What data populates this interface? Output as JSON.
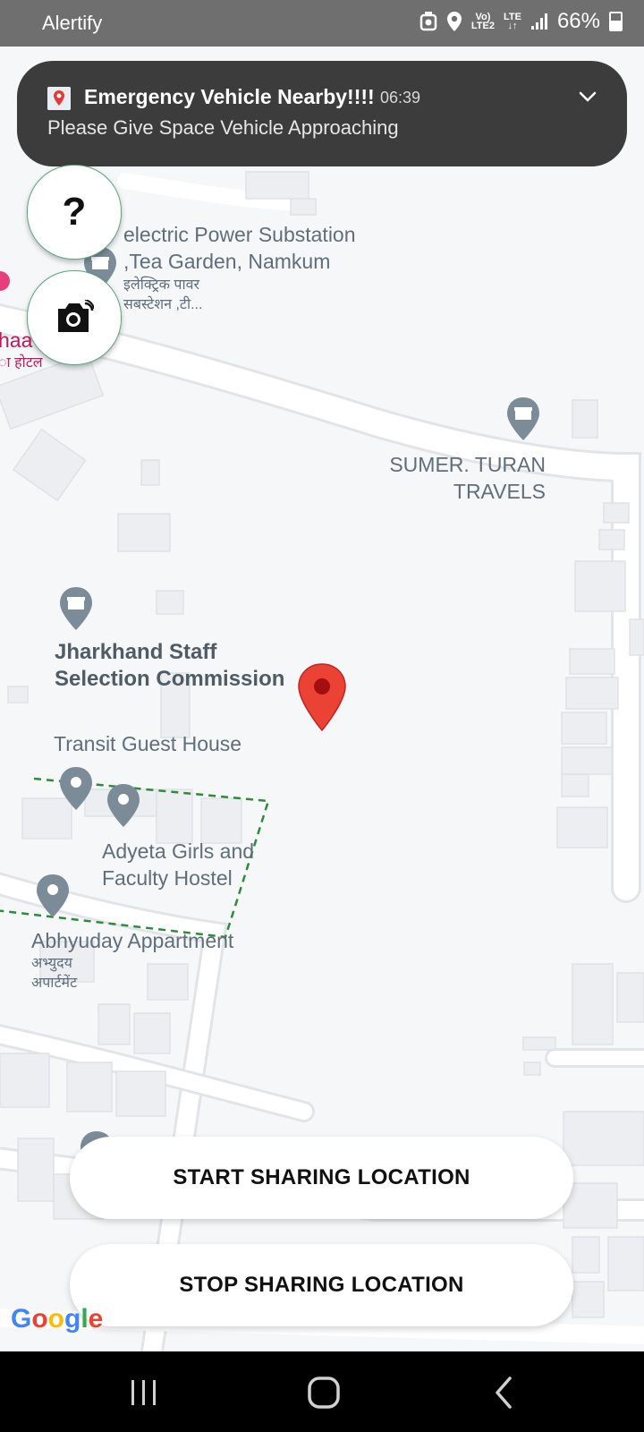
{
  "status_bar": {
    "app_name": "Alertify",
    "network_top": "Vo)",
    "network_bottom": "LTE2",
    "lte_top": "LTE",
    "lte_bottom": "↓↑",
    "battery_percent": "66%"
  },
  "notification": {
    "title": "Emergency Vehicle Nearby!!!!",
    "time": "06:39",
    "text": "Please Give Space Vehicle Approaching"
  },
  "fab": {
    "help_symbol": "?"
  },
  "map": {
    "labels": {
      "substation_en_1": "electric Power Substation",
      "substation_en_2": ",Tea Garden, Namkum",
      "substation_hi_1": "इलेक्ट्रिक पावर",
      "substation_hi_2": "सबस्टेशन ,टी...",
      "hotel_partial_en": "haa",
      "hotel_partial_hi": "ा होटल",
      "sumer_1": "SUMER. TURAN",
      "sumer_2": "TRAVELS",
      "jssc_1": "Jharkhand Staff",
      "jssc_2": "Selection Commission",
      "transit": "Transit Guest House",
      "adyeta_1": "Adyeta Girls and",
      "adyeta_2": "Faculty Hostel",
      "abhyuday_en": "Abhyuday Appartment",
      "abhyuday_hi_1": "अभ्युदय",
      "abhyuday_hi_2": "अपार्टमेंट"
    },
    "attribution": "Google"
  },
  "buttons": {
    "start": "START SHARING LOCATION",
    "stop": "STOP SHARING LOCATION"
  },
  "nav": {
    "recents_icon": "recents-icon",
    "home_icon": "home-icon",
    "back_icon": "back-icon"
  }
}
